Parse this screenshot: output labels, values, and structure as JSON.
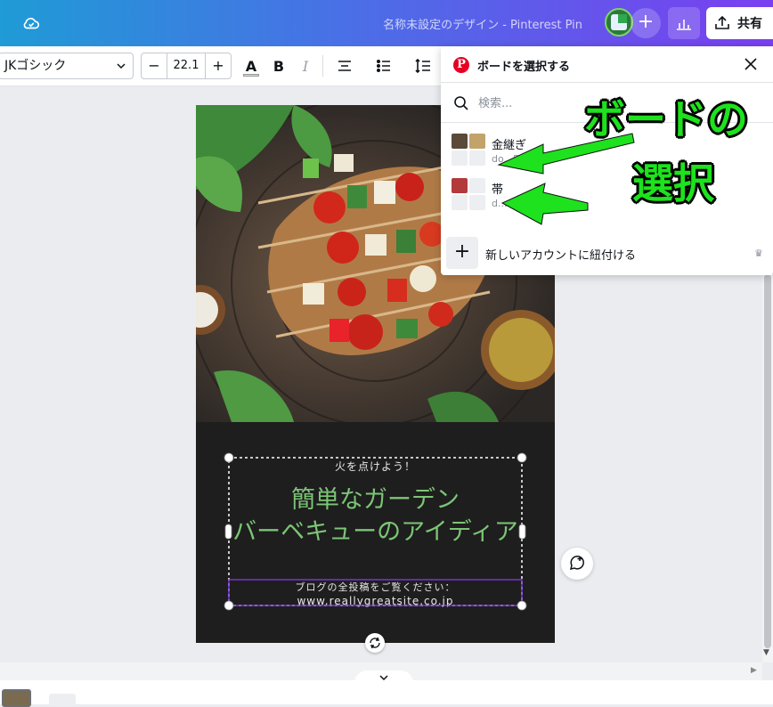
{
  "header": {
    "doc_title": "名称未設定のデザイン - Pinterest Pin",
    "plus_label": "+",
    "share_label": "共有"
  },
  "toolbar": {
    "font_name": "JKゴシック",
    "font_size": "22.1",
    "minus_label": "−",
    "plus_label": "+",
    "color_label": "A",
    "bold_label": "B",
    "italic_label": "I"
  },
  "canvas": {
    "subtitle_top": "火を点けよう！",
    "headline_line1": "簡単なガーデン",
    "headline_line2": "バーベキューのアイディア",
    "footer_line1": "ブログの全投稿をご覧ください：",
    "footer_line2": "www.reallygreatsite.co.jp",
    "headline_color": "#7cc576",
    "background_color": "#1e1e1e"
  },
  "panel": {
    "title": "ボードを選択する",
    "search_placeholder": "検索...",
    "boards": [
      {
        "name": "金継ぎ",
        "owner": "do...528"
      },
      {
        "name": "帯",
        "owner": "d..."
      }
    ],
    "add_account_label": "新しいアカウントに紐付ける",
    "add_icon": "+"
  },
  "annotation": {
    "line1": "ボードの",
    "line2": "選択",
    "color": "#1de21d"
  },
  "bottom": {
    "collapse_icon": "chevron-down-icon"
  }
}
